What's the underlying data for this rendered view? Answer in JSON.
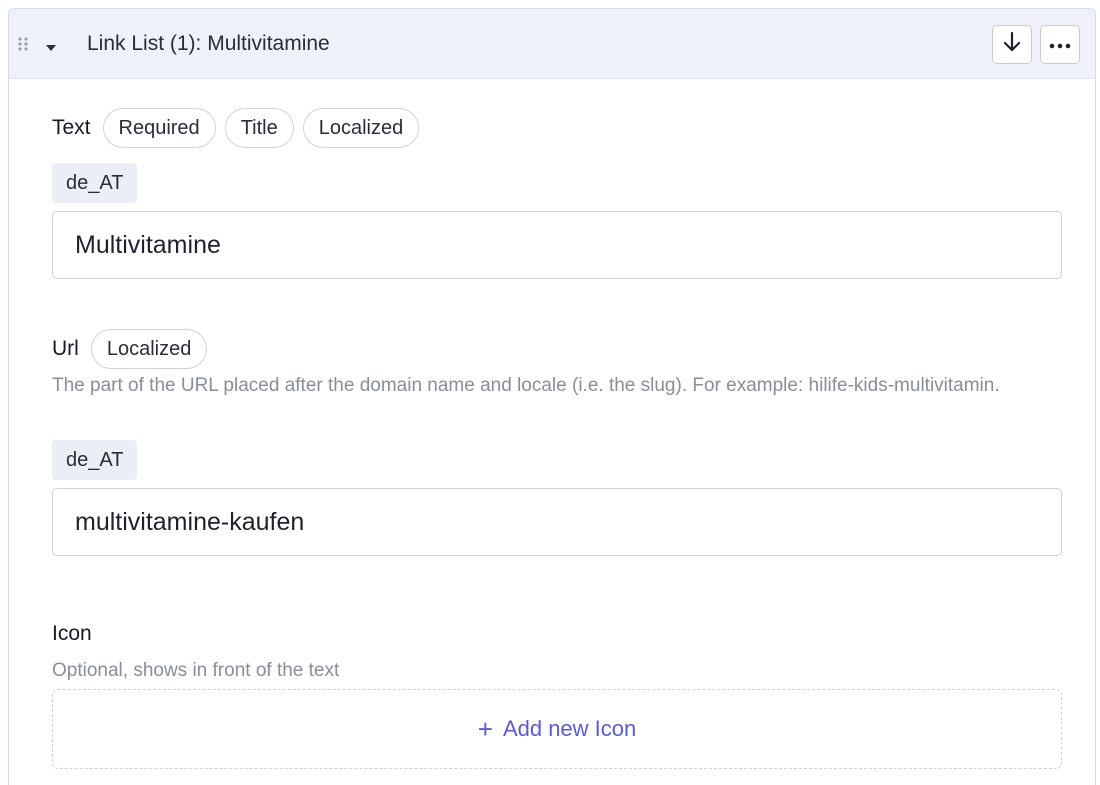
{
  "header": {
    "title": "Link List (1): Multivitamine",
    "icons": {
      "drag": "drag-handle-icon",
      "collapse": "chevron-down-icon",
      "move_down": "arrow-down-icon",
      "more": "more-horizontal-icon"
    }
  },
  "text_field": {
    "label": "Text",
    "tags": [
      "Required",
      "Title",
      "Localized"
    ],
    "locale": "de_AT",
    "value": "Multivitamine"
  },
  "url_field": {
    "label": "Url",
    "tags": [
      "Localized"
    ],
    "description": "The part of the URL placed after the domain name and locale (i.e. the slug). For example: hilife-kids-multivitamin.",
    "locale": "de_AT",
    "value": "multivitamine-kaufen"
  },
  "icon_field": {
    "label": "Icon",
    "description": "Optional, shows in front of the text",
    "add_label": "Add new Icon"
  },
  "colors": {
    "accent": "#5b5bd6",
    "header_bg": "#eff1f9",
    "border": "#cfd2dc",
    "muted_text": "#8a8d9a"
  }
}
